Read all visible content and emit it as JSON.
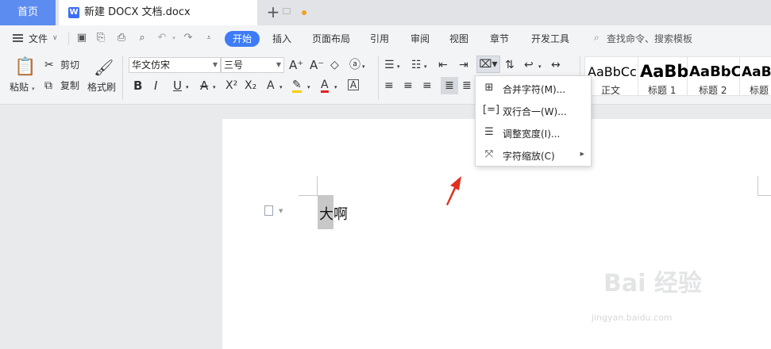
{
  "tabbar": {
    "home": "首页",
    "doc_tab": "新建 DOCX 文档.docx",
    "add": "+"
  },
  "menubar": {
    "file": "文件",
    "tabs": [
      "开始",
      "插入",
      "页面布局",
      "引用",
      "审阅",
      "视图",
      "章节",
      "开发工具"
    ],
    "search": "查找命令、搜索模板"
  },
  "ribbon": {
    "paste": "粘贴",
    "cut": "剪切",
    "copy": "复制",
    "format_painter": "格式刷",
    "font_name": "华文仿宋",
    "font_size": "三号",
    "styles": [
      {
        "sample": "AaBbCcDd",
        "label": "正文"
      },
      {
        "sample": "AaBb",
        "label": "标题 1"
      },
      {
        "sample": "AaBbC",
        "label": "标题 2"
      },
      {
        "sample": "AaBbC",
        "label": "标题"
      }
    ]
  },
  "dropdown": {
    "items": [
      {
        "label": "合并字符(M)...",
        "icon": "merge-chars-icon"
      },
      {
        "label": "双行合一(W)...",
        "icon": "two-lines-icon"
      },
      {
        "label": "调整宽度(I)...",
        "icon": "adjust-width-icon"
      },
      {
        "label": "字符缩放(C)",
        "icon": "char-scale-icon"
      }
    ]
  },
  "document": {
    "text": "大啊"
  },
  "watermark": {
    "brand": "Bai 经验",
    "url": "jingyan.baidu.com"
  },
  "colors": {
    "accent": "#3d7cf6",
    "home_tab": "#5d8cf0",
    "annotation_arrow": "#e0301e"
  }
}
